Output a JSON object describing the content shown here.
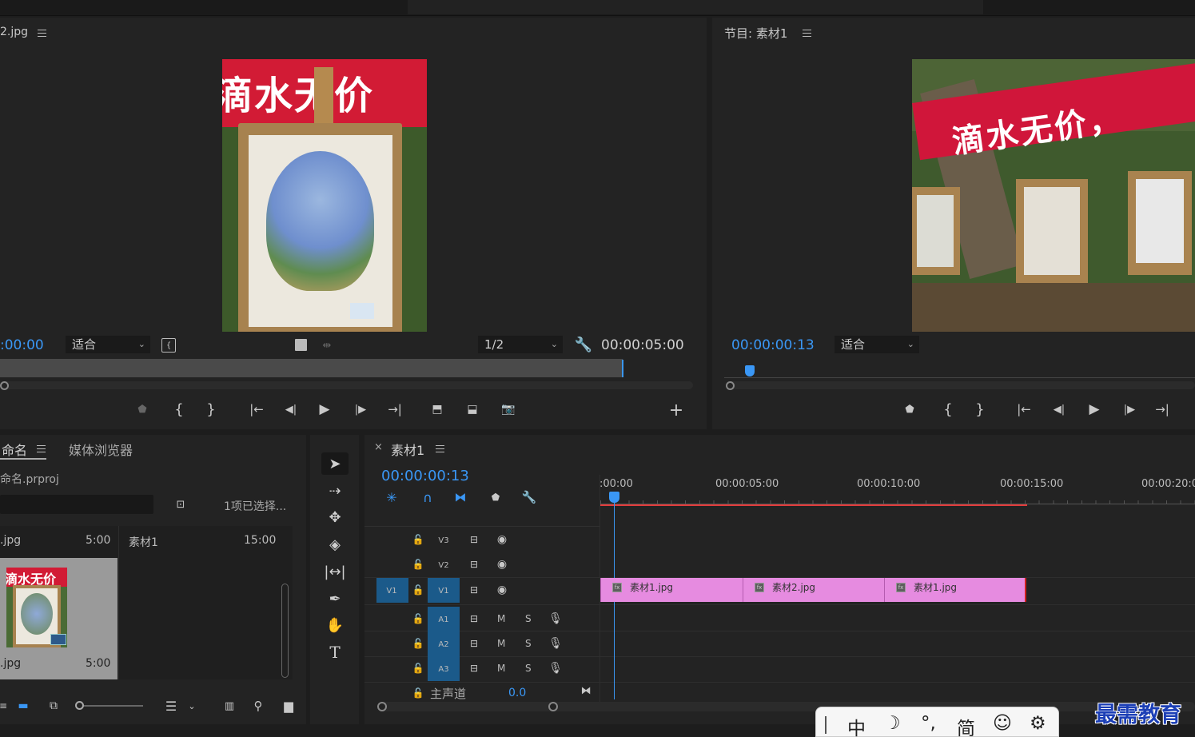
{
  "source_monitor": {
    "title": "2.jpg",
    "timecode": ":00:00",
    "fit": "适合",
    "resolution": "1/2",
    "duration": "00:00:05:00",
    "banner_text": "滴水无价"
  },
  "program_monitor": {
    "title": "节目: 素材1",
    "timecode": "00:00:00:13",
    "fit": "适合",
    "banner_text": "滴水无价，"
  },
  "project_panel": {
    "tab_label": "命名",
    "tab_media_browser": "媒体浏览器",
    "project_file": "命名.prproj",
    "selection_status": "1项已选择...",
    "items": [
      {
        "name": ".jpg",
        "duration": "5:00"
      },
      {
        "name": "素材1",
        "duration": "15:00"
      }
    ],
    "thumb_item": {
      "name": ".jpg",
      "duration": "5:00",
      "banner_text": "滴水无价"
    }
  },
  "timeline": {
    "sequence_name": "素材1",
    "close_label": "×",
    "timecode": "00:00:00:13",
    "ruler_labels": [
      ":00:00",
      "00:00:05:00",
      "00:00:10:00",
      "00:00:15:00",
      "00:00:20:00"
    ],
    "video_tracks": [
      "V3",
      "V2",
      "V1"
    ],
    "audio_tracks": [
      "A1",
      "A2",
      "A3"
    ],
    "source_patch": "V1",
    "mute_label": "M",
    "solo_label": "S",
    "master_label": "主声道",
    "master_value": "0.0",
    "clips": [
      {
        "name": "素材1.jpg",
        "fx": "fx"
      },
      {
        "name": "素材2.jpg",
        "fx": "fx"
      },
      {
        "name": "素材1.jpg",
        "fx": "fx"
      }
    ]
  },
  "ime_toolbar": {
    "items": [
      "中",
      "☽",
      "°,",
      "简",
      "☺",
      "⚙"
    ]
  },
  "watermark": "最需教育",
  "colors": {
    "accent_blue": "#3a97f5",
    "clip_pink": "#e68be0",
    "playhead_red": "#e23b3b",
    "panel_bg": "#232323"
  }
}
